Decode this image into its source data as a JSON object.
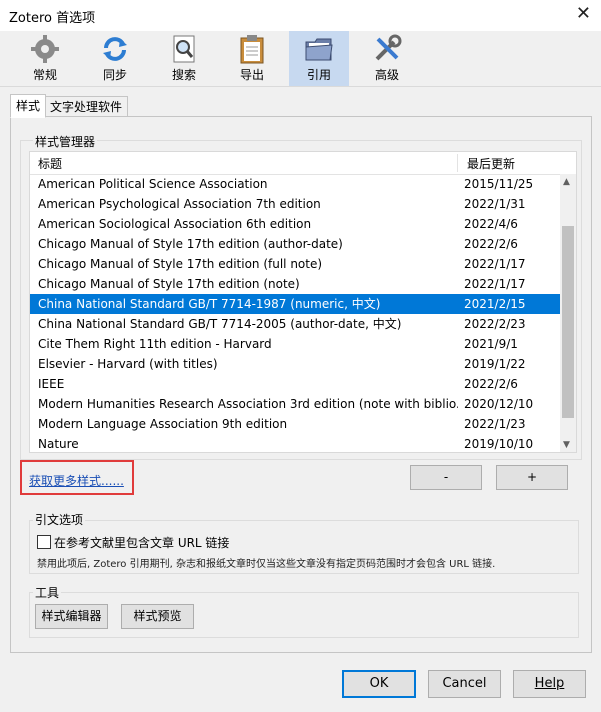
{
  "window": {
    "title": "Zotero 首选项",
    "close": "✕"
  },
  "toolbar": {
    "items": [
      {
        "label": "常规",
        "icon": "gear-icon"
      },
      {
        "label": "同步",
        "icon": "sync-icon"
      },
      {
        "label": "搜索",
        "icon": "search-icon"
      },
      {
        "label": "导出",
        "icon": "clipboard-icon"
      },
      {
        "label": "引用",
        "icon": "folder-icon",
        "active": true
      },
      {
        "label": "高级",
        "icon": "tools-icon"
      }
    ]
  },
  "tabs": [
    {
      "label": "样式",
      "selected": true
    },
    {
      "label": "文字处理软件",
      "selected": false
    }
  ],
  "style_manager": {
    "legend": "样式管理器",
    "col_title": "标题",
    "col_updated": "最后更新",
    "rows": [
      {
        "title": "American Political Science Association",
        "updated": "2015/11/25"
      },
      {
        "title": "American Psychological Association 7th edition",
        "updated": "2022/1/31"
      },
      {
        "title": "American Sociological Association 6th edition",
        "updated": "2022/4/6"
      },
      {
        "title": "Chicago Manual of Style 17th edition (author-date)",
        "updated": "2022/2/6"
      },
      {
        "title": "Chicago Manual of Style 17th edition (full note)",
        "updated": "2022/1/17"
      },
      {
        "title": "Chicago Manual of Style 17th edition (note)",
        "updated": "2022/1/17"
      },
      {
        "title": "China National Standard GB/T 7714-1987 (numeric, 中文)",
        "updated": "2021/2/15",
        "selected": true
      },
      {
        "title": "China National Standard GB/T 7714-2005 (author-date, 中文)",
        "updated": "2022/2/23"
      },
      {
        "title": "Cite Them Right 11th edition - Harvard",
        "updated": "2021/9/1"
      },
      {
        "title": "Elsevier - Harvard (with titles)",
        "updated": "2019/1/22"
      },
      {
        "title": "IEEE",
        "updated": "2022/2/6"
      },
      {
        "title": "Modern Humanities Research Association 3rd edition (note with biblio...",
        "updated": "2020/12/10"
      },
      {
        "title": "Modern Language Association 9th edition",
        "updated": "2022/1/23"
      },
      {
        "title": "Nature",
        "updated": "2019/10/10"
      }
    ],
    "get_more": "获取更多样式......",
    "remove": "-",
    "add": "+"
  },
  "citation_options": {
    "legend": "引文选项",
    "checkbox_label": "在参考文献里包含文章 URL 链接",
    "note": "禁用此项后, Zotero 引用期刊, 杂志和报纸文章时仅当这些文章没有指定页码范围时才会包含 URL 链接."
  },
  "tools": {
    "legend": "工具",
    "style_editor": "样式编辑器",
    "style_preview": "样式预览"
  },
  "footer": {
    "ok": "OK",
    "cancel": "Cancel",
    "help": "Help"
  }
}
